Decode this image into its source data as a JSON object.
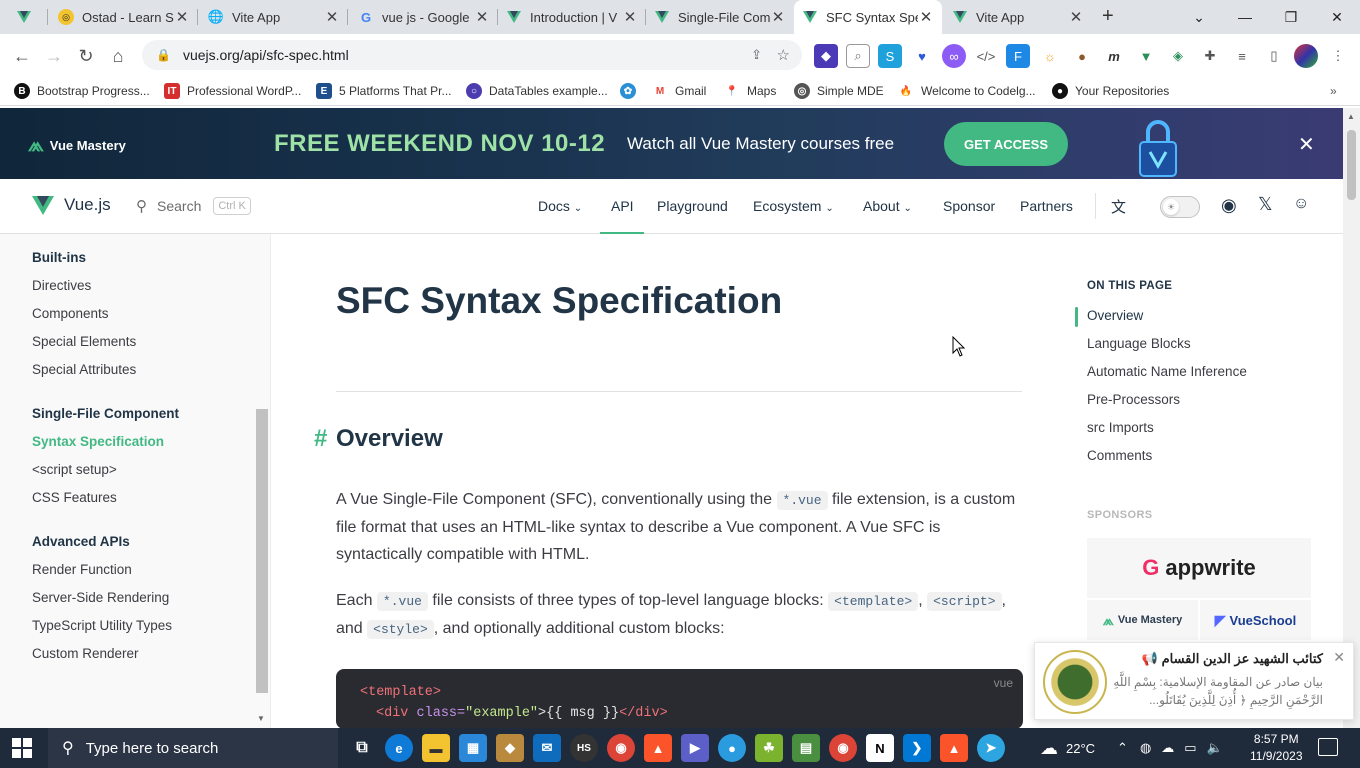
{
  "browser": {
    "tabs": [
      {
        "title": "",
        "icon": "vue-icon"
      },
      {
        "title": "Ostad - Learn S",
        "icon": "ostad-icon"
      },
      {
        "title": "Vite App",
        "icon": "globe-icon"
      },
      {
        "title": "vue js - Google",
        "icon": "google-icon"
      },
      {
        "title": "Introduction | V",
        "icon": "vue-icon"
      },
      {
        "title": "Single-File Com",
        "icon": "vue-icon"
      },
      {
        "title": "SFC Syntax Spe",
        "icon": "vue-icon"
      },
      {
        "title": "Vite App",
        "icon": "vue-icon"
      }
    ],
    "url": "vuejs.org/api/sfc-spec.html",
    "bookmarks": [
      "Bootstrap Progress...",
      "Professional WordP...",
      "5 Platforms That Pr...",
      "DataTables example...",
      "",
      "Gmail",
      "Maps",
      "Simple MDE",
      "Welcome to Codelg...",
      "Your Repositories"
    ]
  },
  "banner": {
    "brand": "Vue Mastery",
    "promo": "FREE WEEKEND NOV 10-12",
    "text": "Watch all Vue Mastery courses free",
    "cta": "GET ACCESS",
    "accent": "#42b883"
  },
  "nav": {
    "brand": "Vue.js",
    "search": "Search",
    "shortcut": "Ctrl K",
    "links": [
      "Docs",
      "API",
      "Playground",
      "Ecosystem",
      "About",
      "Sponsor",
      "Partners"
    ],
    "active": "API"
  },
  "sidebar": {
    "groups": [
      {
        "title": "Built-ins",
        "items": [
          "Directives",
          "Components",
          "Special Elements",
          "Special Attributes"
        ]
      },
      {
        "title": "Single-File Component",
        "items": [
          "Syntax Specification",
          "<script setup>",
          "CSS Features"
        ]
      },
      {
        "title": "Advanced APIs",
        "items": [
          "Render Function",
          "Server-Side Rendering",
          "TypeScript Utility Types",
          "Custom Renderer"
        ]
      }
    ],
    "active": "Syntax Specification"
  },
  "main": {
    "title": "SFC Syntax Specification",
    "section_hash": "#",
    "section_title": "Overview",
    "p1_a": "A Vue Single-File Component (SFC), conventionally using the",
    "p1_code": "*.vue",
    "p1_b": "file extension, is a custom file format that uses an HTML-like syntax to describe a Vue component. A Vue SFC is syntactically compatible with HTML.",
    "p2_a": "Each",
    "p2_code1": "*.vue",
    "p2_b": "file consists of three types of top-level language blocks:",
    "p2_code2": "<template>",
    "p2_c": ",",
    "p2_code3": "<script>",
    "p2_d": ", and",
    "p2_code4": "<style>",
    "p2_e": ", and optionally additional custom blocks:",
    "code_lang": "vue",
    "code_line1_tag": "<template>",
    "code_line2_open": "<div",
    "code_line2_attr": "class=",
    "code_line2_str": "\"example\"",
    "code_line2_rest": ">{{ msg }}",
    "code_line2_close": "</div>"
  },
  "aside": {
    "title": "ON THIS PAGE",
    "items": [
      "Overview",
      "Language Blocks",
      "Automatic Name Inference",
      "Pre-Processors",
      "src Imports",
      "Comments"
    ],
    "active": "Overview",
    "sponsors_title": "SPONSORS",
    "sponsors": [
      "appwrite",
      "Vue Mastery",
      "VueSchool"
    ]
  },
  "notification": {
    "title": "كتائب الشهيد عز الدين القسام 📢",
    "body": "بيان صادر عن المقاومة الإسلامية: بِسْمِ اللَّهِ الرَّحْمَنِ الرَّحِيمِ ﴿ أُذِنَ لِلَّذِينَ يُقَاتَلُو..."
  },
  "taskbar": {
    "search_placeholder": "Type here to search",
    "weather": "22°C",
    "time": "8:57 PM",
    "date": "11/9/2023"
  }
}
